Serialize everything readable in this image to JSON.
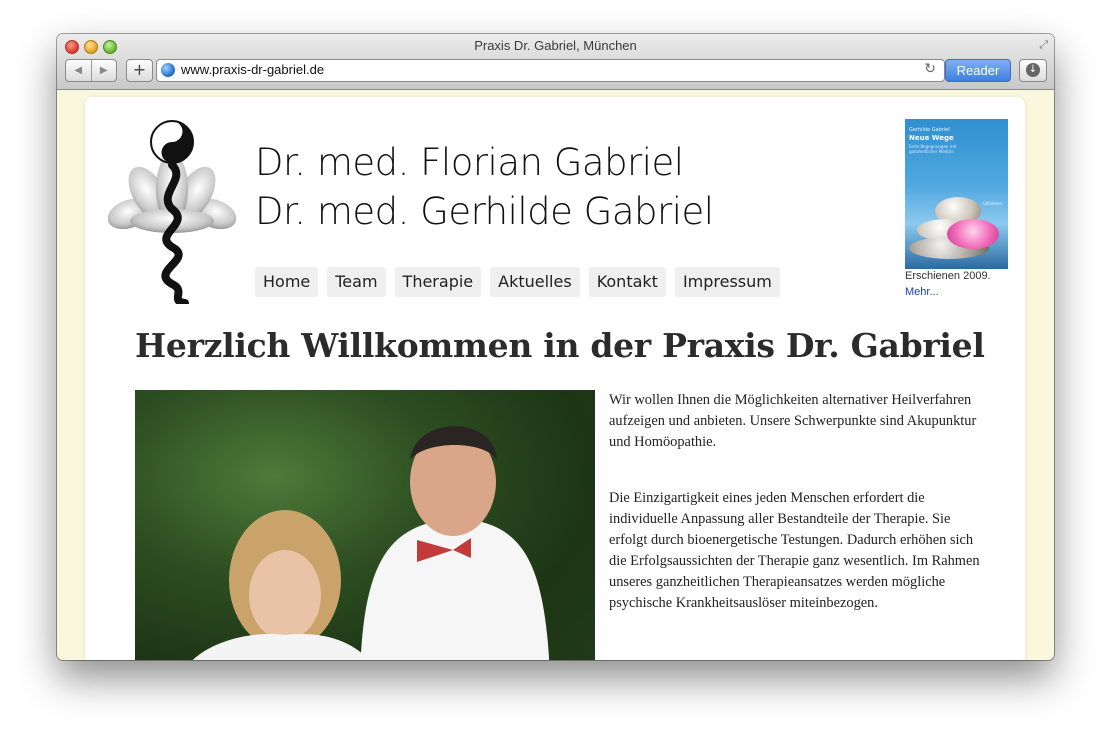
{
  "browser": {
    "window_title": "Praxis Dr. Gabriel, München",
    "url": "www.praxis-dr-gabriel.de",
    "reader_label": "Reader",
    "back_icon": "back-arrow-icon",
    "forward_icon": "forward-arrow-icon",
    "add_icon": "plus-icon",
    "reload_icon": "reload-icon",
    "download_icon": "download-icon"
  },
  "site": {
    "name_line1": "Dr. med. Florian Gabriel",
    "name_line2": "Dr. med. Gerhilde Gabriel",
    "nav": [
      "Home",
      "Team",
      "Therapie",
      "Aktuelles",
      "Kontakt",
      "Impressum"
    ],
    "book": {
      "author": "Gerhilde Gabriel",
      "title": "Neue Wege",
      "subtitle": "Erste Begegnungen mit ganzheitlicher Medizin",
      "publisher": "Litmimen",
      "caption": "Erschienen 2009.",
      "more": "Mehr..."
    },
    "heading": "Herzlich Willkommen in der Praxis Dr. Gabriel",
    "paragraph1": "Wir wollen Ihnen die Möglichkeiten alternativer Heilverfahren aufzeigen und anbieten. Unsere Schwerpunkte sind Akupunktur und Homöopa­thie.",
    "paragraph2": "Die Einzigartigkeit eines jeden Menschen erfordert die individuelle Anpassung aller Bestandteile der Therapie. Sie erfolgt durch bioenergetische Tes­tungen. Dadurch erhöhen sich die Erfolgsaussich­ten der Therapie ganz wesentlich. Im Rahmen un­seres ganzheitlichen Therapieansatzes werden mögliche psychische Krankheitsauslöser miteinbe­zogen."
  }
}
